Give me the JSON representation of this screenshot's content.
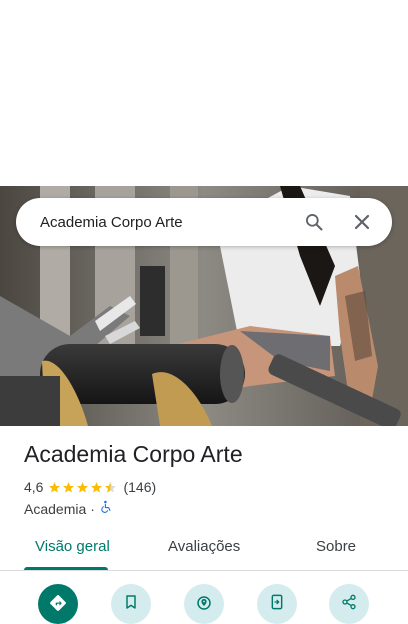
{
  "search": {
    "query": "Academia Corpo Arte"
  },
  "place": {
    "name": "Academia Corpo Arte",
    "rating": "4,6",
    "rating_value": 4.6,
    "reviews": "(146)",
    "category": "Academia",
    "separator": "·"
  },
  "tabs": [
    {
      "label": "Visão geral",
      "active": true
    },
    {
      "label": "Avaliações",
      "active": false
    },
    {
      "label": "Sobre",
      "active": false
    }
  ],
  "actions": [
    {
      "icon": "directions-icon",
      "primary": true
    },
    {
      "icon": "bookmark-icon",
      "primary": false
    },
    {
      "icon": "nearby-icon",
      "primary": false
    },
    {
      "icon": "send-to-phone-icon",
      "primary": false
    },
    {
      "icon": "share-icon",
      "primary": false
    }
  ],
  "colors": {
    "accent": "#00796b",
    "star": "#fbbc04",
    "action_bg": "#d5ecee",
    "accessible": "#1a73e8"
  }
}
